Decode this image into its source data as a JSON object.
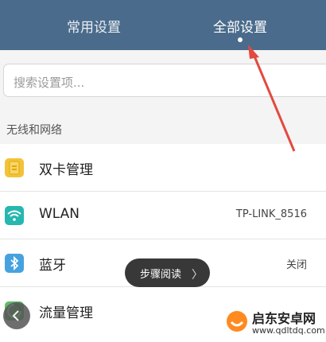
{
  "tabs": {
    "common": "常用设置",
    "all": "全部设置"
  },
  "search": {
    "placeholder": "搜索设置项..."
  },
  "section": {
    "title": "无线和网络"
  },
  "rows": [
    {
      "label": "双卡管理",
      "value": "",
      "icon": "sim-card-icon",
      "color": "#f2c33a"
    },
    {
      "label": "WLAN",
      "value": "TP-LINK_8516",
      "icon": "wifi-icon",
      "color": "#25b7b0"
    },
    {
      "label": "蓝牙",
      "value": "关闭",
      "icon": "bluetooth-icon",
      "color": "#46a2df"
    },
    {
      "label": "流量管理",
      "value": "",
      "icon": "data-usage-icon",
      "color": "#5fbb67"
    }
  ],
  "toast": {
    "text": "步骤阅读",
    "chevron": "〉"
  },
  "watermark": {
    "brand": "启东安卓网",
    "url": "www.qdltdq.com"
  },
  "colors": {
    "header": "#4a6b8b",
    "arrow": "#e34a3f"
  }
}
